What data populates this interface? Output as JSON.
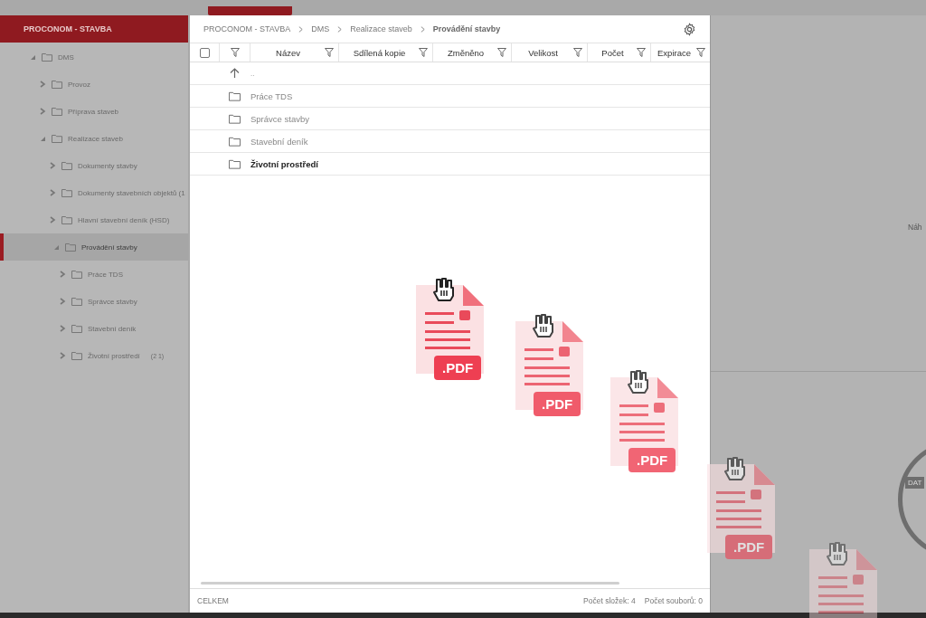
{
  "sidebar": {
    "title": "PROCONOM - STAVBA",
    "tree": [
      {
        "label": "DMS",
        "expanded": true,
        "selected": false,
        "children": [
          {
            "label": "Provoz",
            "expanded": false,
            "selected": false
          },
          {
            "label": "Příprava staveb",
            "expanded": false,
            "selected": false
          },
          {
            "label": "Realizace staveb",
            "expanded": true,
            "selected": false,
            "children": [
              {
                "label": "Dokumenty stavby",
                "expanded": false,
                "selected": false
              },
              {
                "label": "Dokumenty stavebních objektů (1",
                "expanded": false,
                "selected": false
              },
              {
                "label": "Hlavní stavební deník (HSD)",
                "expanded": false,
                "selected": false
              },
              {
                "label": "Provádění stavby",
                "expanded": true,
                "selected": true,
                "children": [
                  {
                    "label": "Práce TDS",
                    "expanded": false,
                    "selected": false
                  },
                  {
                    "label": "Správce stavby",
                    "expanded": false,
                    "selected": false
                  },
                  {
                    "label": "Stavební deník",
                    "expanded": false,
                    "selected": false
                  },
                  {
                    "label": "Životní prostředí",
                    "count": "(2 1)",
                    "expanded": false,
                    "selected": false
                  }
                ]
              }
            ]
          }
        ]
      }
    ]
  },
  "breadcrumb": [
    "PROCONOM - STAVBA",
    "DMS",
    "Realizace staveb",
    "Provádění stavby"
  ],
  "table": {
    "select_all_checked": false,
    "columns": [
      "Název",
      "Sdílená kopie",
      "Změněno",
      "Velikost",
      "Počet",
      "Expirace"
    ],
    "up_row": "..",
    "rows": [
      {
        "name": "Práce TDS",
        "selected": false
      },
      {
        "name": "Správce stavby",
        "selected": false
      },
      {
        "name": "Stavební deník",
        "selected": false
      },
      {
        "name": "Životní prostředí",
        "selected": true
      }
    ]
  },
  "footer": {
    "total": "CELKEM",
    "folders": "Počet složek: 4",
    "files": "Počet souborů: 0"
  },
  "background": {
    "side_text": "Náh",
    "badge": "DAT"
  },
  "dragged_files": [
    {
      "kind": "document",
      "label": ".PDF"
    },
    {
      "kind": "document",
      "label": ".PDF"
    },
    {
      "kind": "document",
      "label": ".PDF"
    },
    {
      "kind": "document",
      "label": ".PDF"
    },
    {
      "kind": "document"
    }
  ]
}
